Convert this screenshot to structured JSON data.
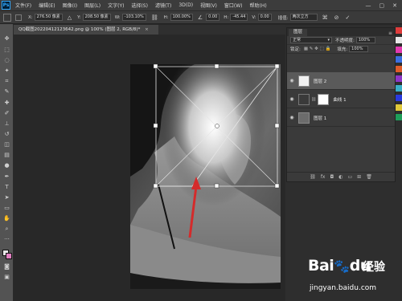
{
  "app": {
    "logo": "Ps",
    "menu": [
      "文件(F)",
      "编辑(E)",
      "图像(I)",
      "图层(L)",
      "文字(Y)",
      "选择(S)",
      "滤镜(T)",
      "3D(D)",
      "视图(V)",
      "窗口(W)",
      "帮助(H)"
    ],
    "window_buttons": [
      "—",
      "▢",
      "✕"
    ]
  },
  "options_bar": {
    "x_label": "X:",
    "x_value": "276.50 像素",
    "y_label": "Y:",
    "y_value": "208.50 像素",
    "w_label": "W:",
    "w_value": "-103.10%",
    "h_label": "H:",
    "h_value": "100.00%",
    "angle_value": "0.00",
    "h_skew_label": "H:",
    "h_skew_value": "-45.44",
    "v_skew_label": "V:",
    "v_skew_value": "0.00",
    "interp_label": "插值:",
    "interp_value": "两次立方",
    "cancel_icon": "cancel-icon",
    "commit_icon": "check-icon"
  },
  "document_tab": {
    "title": "QQ截图20220412123642.png @ 100% (图层 2, RGB/8)",
    "modified_mark": "*",
    "close": "×"
  },
  "layers_panel": {
    "tab_label": "图层",
    "menu_icon": "≡",
    "blend_mode": "正常",
    "opacity_label": "不透明度:",
    "opacity_value": "100%",
    "lock_label": "锁定:",
    "fill_label": "填充:",
    "fill_value": "100%",
    "layers": [
      {
        "name": "图层 2",
        "visible": true,
        "selected": true
      },
      {
        "name": "曲线 1",
        "visible": true,
        "selected": false
      },
      {
        "name": "图层 1",
        "visible": true,
        "selected": false
      }
    ]
  },
  "watermark": {
    "brand": "Bai",
    "brand_paw": "du",
    "product": "经验",
    "url": "jingyan.baidu.com"
  },
  "colors": {
    "accent": "#31a8ff",
    "arrow": "#d42b2b",
    "swatches": [
      "#e03c3c",
      "#e8e8e8",
      "#e23ab0",
      "#3c6fe0",
      "#e05c2a",
      "#8e36c8",
      "#3ab0c8",
      "#2a3ae0",
      "#e0c83a",
      "#1e9e5a"
    ]
  }
}
